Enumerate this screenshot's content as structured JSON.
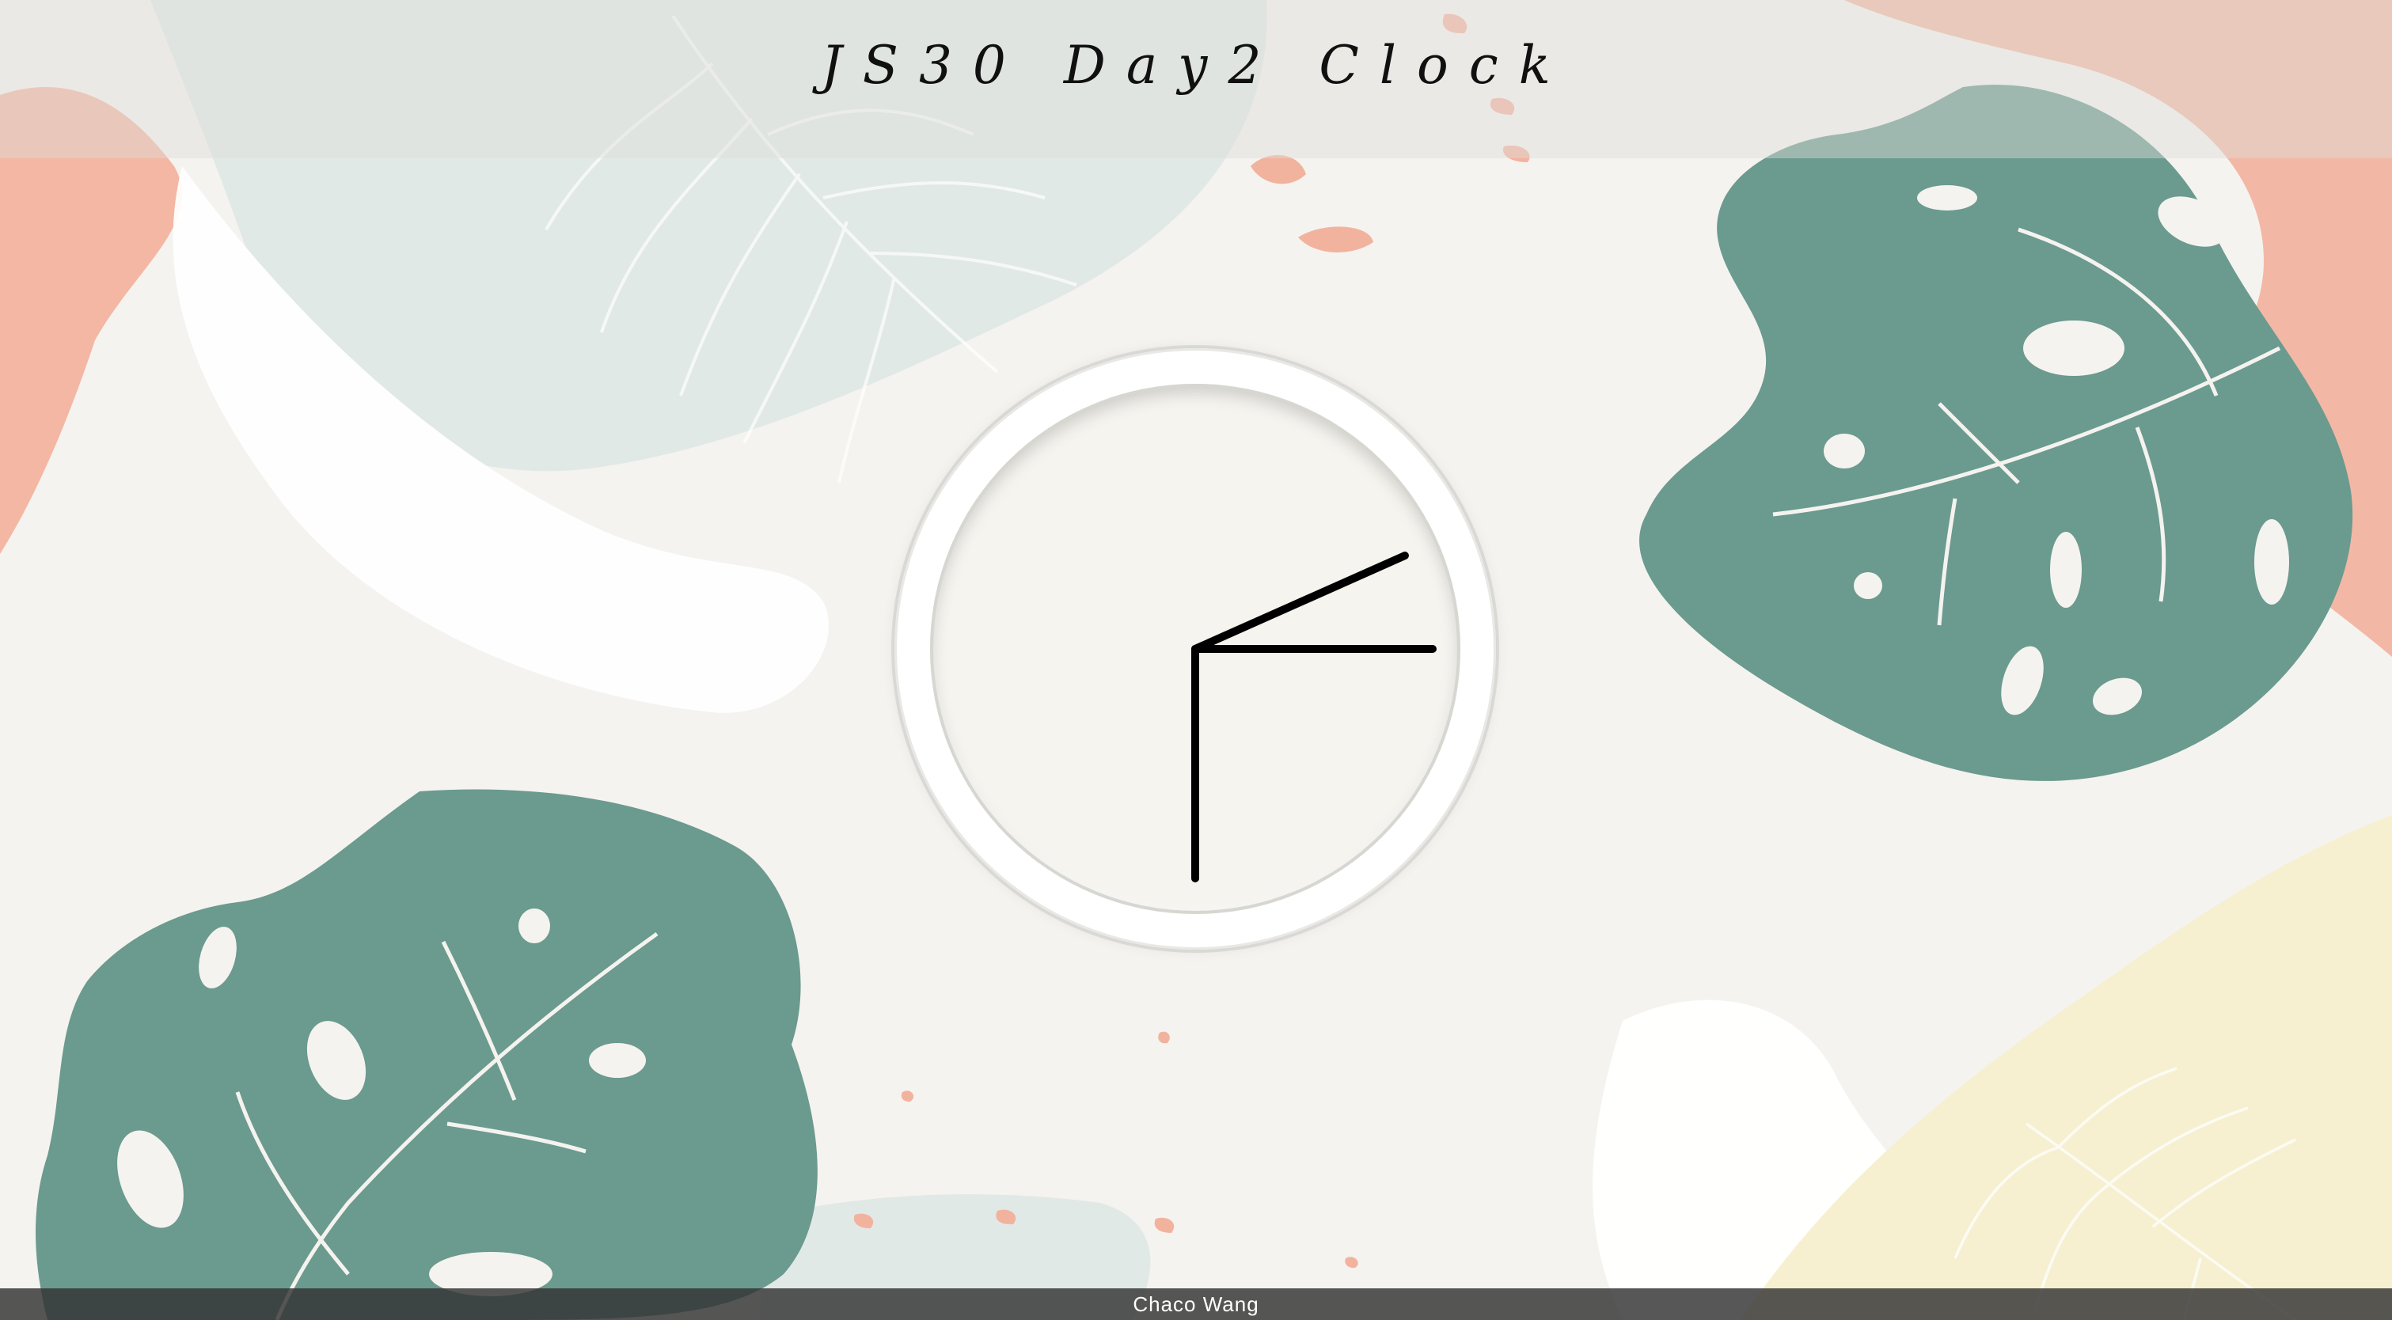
{
  "header": {
    "title": "JS30 Day2 Clock"
  },
  "clock": {
    "hour_hand_angle_deg": -24,
    "minute_hand_angle_deg": 0,
    "second_hand_angle_deg": 90
  },
  "footer": {
    "author": "Chaco Wang"
  },
  "colors": {
    "leaf_green": "#6b9a8f",
    "peach": "#f2b39e",
    "mint": "#dfe8e5",
    "cream": "#f6efcf",
    "white": "#ffffff",
    "background": "#f5f3ef",
    "hand": "#000000"
  }
}
